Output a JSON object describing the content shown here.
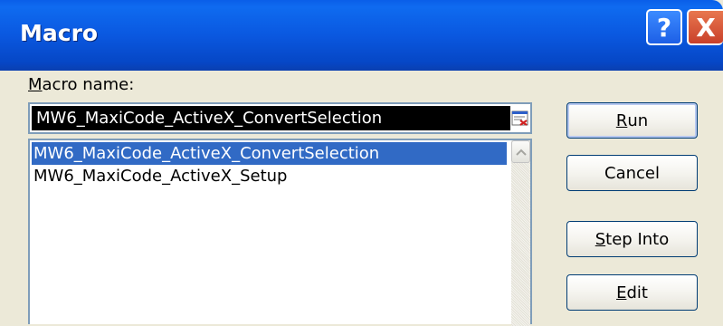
{
  "window": {
    "title": "Macro",
    "help_glyph": "?",
    "close_glyph": "X"
  },
  "macro_name": {
    "label_underlined": "M",
    "label_rest": "acro name:",
    "value": "MW6_MaxiCode_ActiveX_ConvertSelection"
  },
  "macro_list": {
    "items": [
      {
        "label": "MW6_MaxiCode_ActiveX_ConvertSelection",
        "selected": true
      },
      {
        "label": "MW6_MaxiCode_ActiveX_Setup",
        "selected": false
      }
    ]
  },
  "buttons": {
    "run": {
      "underlined": "R",
      "rest": "un"
    },
    "cancel": {
      "label": "Cancel"
    },
    "step_into": {
      "underlined": "S",
      "rest": "tep Into"
    },
    "edit": {
      "underlined": "E",
      "rest": "dit"
    }
  },
  "colors": {
    "titlebar": "#0a58e0",
    "selection": "#316ac5",
    "dialog_bg": "#ece9d8",
    "close_button": "#c9402a"
  },
  "icons": {
    "help": "help-icon",
    "close": "close-icon",
    "collapse": "collapse-dialog-icon",
    "scroll_up": "scroll-up-arrow-icon"
  }
}
